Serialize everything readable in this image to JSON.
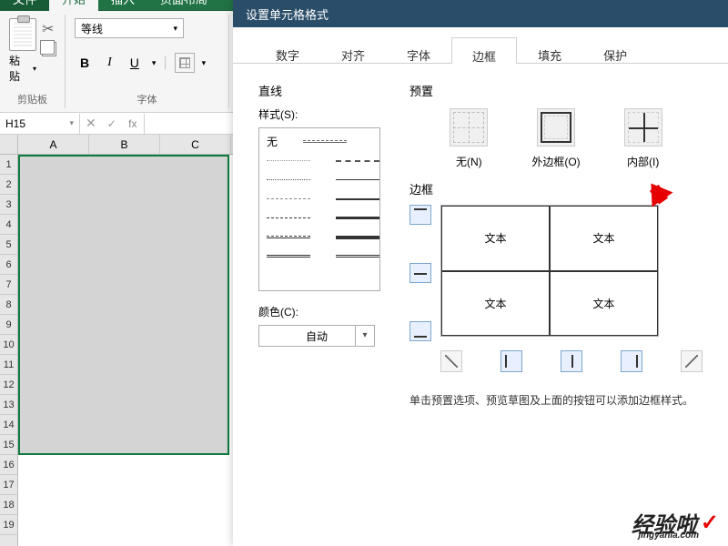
{
  "app_tabs": {
    "file": "文件",
    "start": "开始",
    "insert": "插入",
    "layout": "页面布局"
  },
  "ribbon": {
    "clipboard": {
      "paste": "粘贴",
      "group": "剪贴板"
    },
    "font": {
      "name": "等线",
      "group": "字体",
      "b": "B",
      "i": "I",
      "u": "U"
    }
  },
  "namebox": "H15",
  "fx": "fx",
  "columns": [
    "A",
    "B",
    "C"
  ],
  "rows": [
    "1",
    "2",
    "3",
    "4",
    "5",
    "6",
    "7",
    "8",
    "9",
    "10",
    "11",
    "12",
    "13",
    "14",
    "15",
    "16",
    "17",
    "18",
    "19"
  ],
  "dialog": {
    "title": "设置单元格格式",
    "tabs": [
      "数字",
      "对齐",
      "字体",
      "边框",
      "填充",
      "保护"
    ],
    "active_tab": 3,
    "line": {
      "section": "直线",
      "style": "样式(S):",
      "none": "无",
      "color": "颜色(C):",
      "auto": "自动"
    },
    "preset": {
      "section": "预置",
      "none": "无(N)",
      "outer": "外边框(O)",
      "inner": "内部(I)"
    },
    "border": {
      "section": "边框",
      "sample": "文本"
    },
    "hint": "单击预置选项、预览草图及上面的按钮可以添加边框样式。"
  },
  "watermark": {
    "main": "经验啦",
    "sub": "jingyanla.com",
    "check": "✓"
  }
}
